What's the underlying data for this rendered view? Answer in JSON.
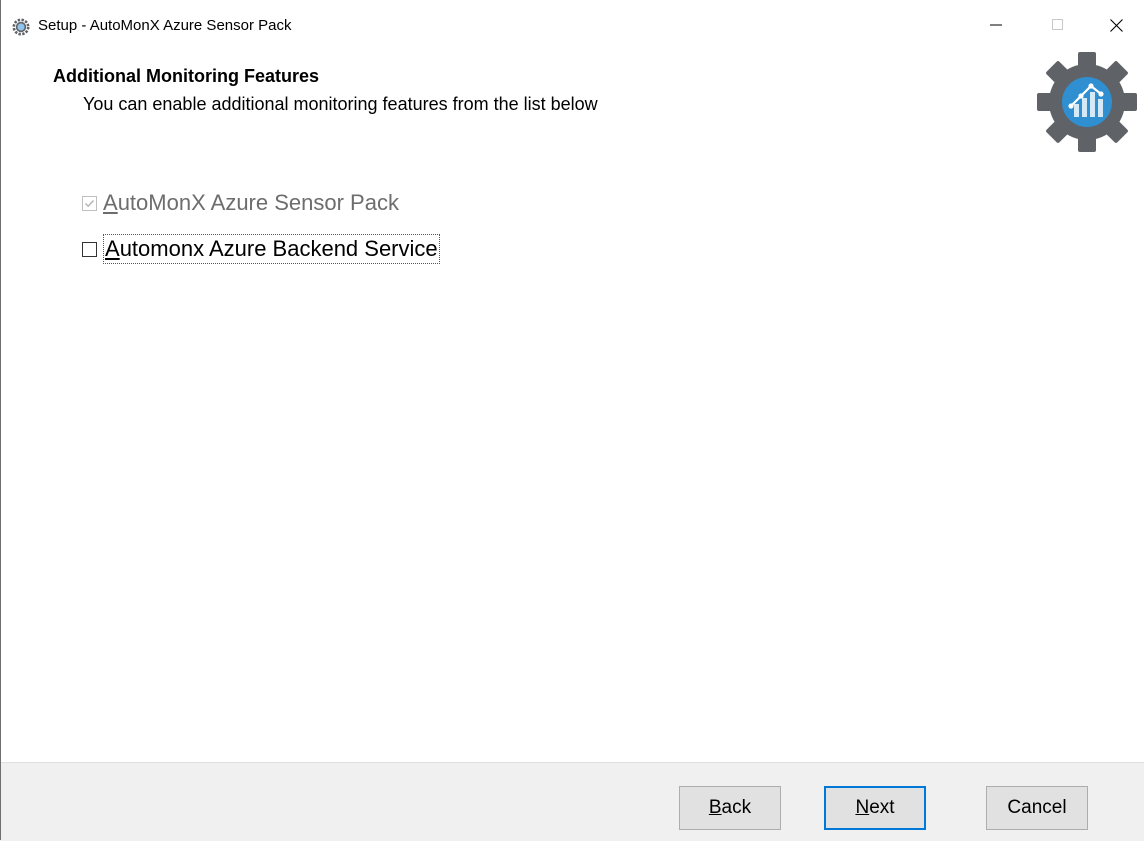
{
  "window": {
    "title": "Setup - AutoMonX Azure Sensor Pack",
    "icon": "gear-app-icon",
    "controls": [
      "minimize-icon",
      "maximize-icon",
      "close-icon"
    ]
  },
  "header": {
    "title": "Additional Monitoring Features",
    "subtitle": "You can enable additional monitoring features from the list below",
    "logo_icon": "gear-chart-logo-icon"
  },
  "options": [
    {
      "mnemonic": "A",
      "rest": "utoMonX Azure Sensor Pack",
      "checked": true,
      "enabled": false
    },
    {
      "mnemonic": "A",
      "rest": "utomonx Azure Backend Service",
      "checked": false,
      "enabled": true
    }
  ],
  "buttons": {
    "back": {
      "mnemonic": "B",
      "rest": "ack"
    },
    "next": {
      "mnemonic": "N",
      "rest": "ext"
    },
    "cancel": {
      "label": "Cancel"
    }
  },
  "colors": {
    "accent": "#0078d7",
    "footer_bg": "#f0f0f0",
    "logo_gear": "#5f6266",
    "logo_circle": "#2f8fd0",
    "disabled_text": "#6d6d6d"
  }
}
